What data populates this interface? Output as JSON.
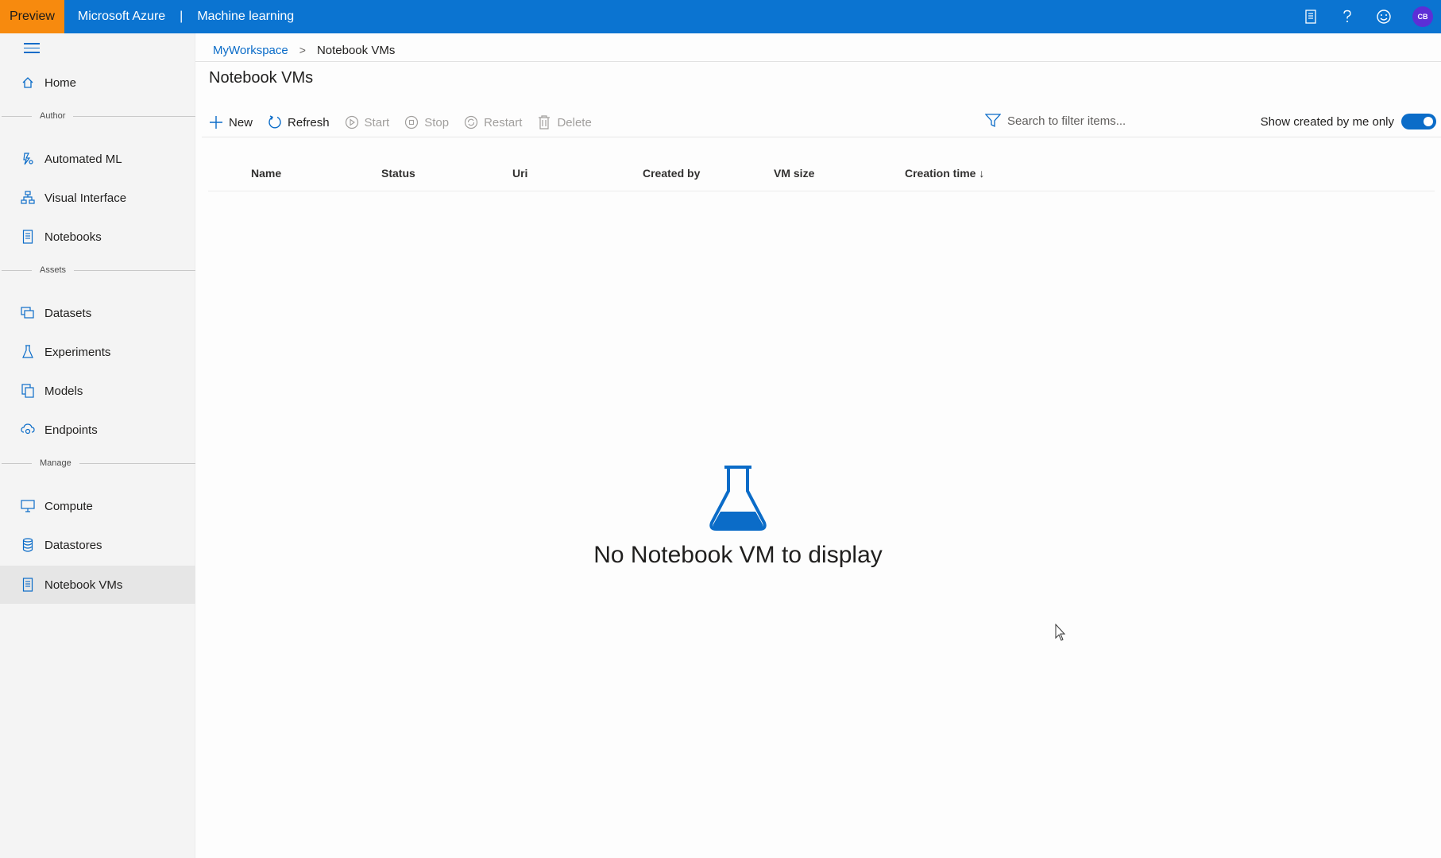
{
  "topbar": {
    "preview_label": "Preview",
    "brand": "Microsoft Azure",
    "separator": "|",
    "product": "Machine learning",
    "avatar_initials": "CB",
    "colors": {
      "bar": "#0b74d1",
      "preview": "#f78a0e",
      "avatar": "#5c2fd6"
    },
    "icons": [
      "notes-icon",
      "help-icon",
      "smiley-icon"
    ]
  },
  "sidebar": {
    "items": {
      "home": "Home",
      "automated_ml": "Automated ML",
      "visual_interface": "Visual Interface",
      "notebooks": "Notebooks",
      "datasets": "Datasets",
      "experiments": "Experiments",
      "models": "Models",
      "endpoints": "Endpoints",
      "compute": "Compute",
      "datastores": "Datastores",
      "notebook_vms": "Notebook VMs"
    },
    "sections": {
      "author": "Author",
      "assets": "Assets",
      "manage": "Manage"
    },
    "active": "Notebook VMs"
  },
  "breadcrumb": {
    "workspace": "MyWorkspace",
    "separator": ">",
    "current": "Notebook VMs"
  },
  "page": {
    "title": "Notebook VMs"
  },
  "toolbar": {
    "new": "New",
    "refresh": "Refresh",
    "start": "Start",
    "stop": "Stop",
    "restart": "Restart",
    "delete": "Delete"
  },
  "search": {
    "placeholder": "Search to filter items..."
  },
  "filter_toggle": {
    "label": "Show created by me only",
    "on": true
  },
  "table": {
    "columns": [
      "Name",
      "Status",
      "Uri",
      "Created by",
      "VM size",
      "Creation time ↓"
    ],
    "rows": []
  },
  "empty_state": {
    "message": "No Notebook VM to display",
    "icon": "flask-icon",
    "icon_color": "#0b6cc8"
  }
}
